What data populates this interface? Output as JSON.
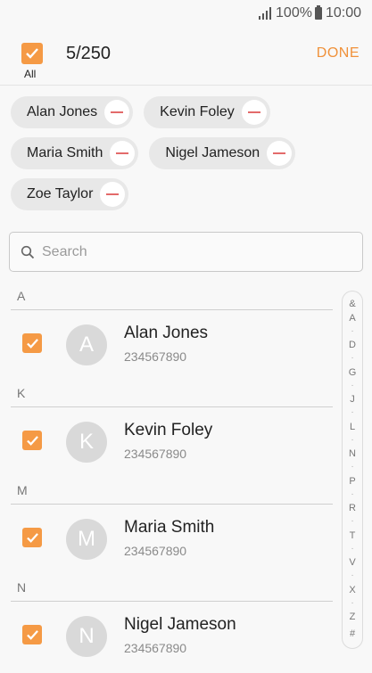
{
  "status_bar": {
    "battery_percent": "100%",
    "time": "10:00"
  },
  "header": {
    "all_label": "All",
    "selected_count": "5/250",
    "done_label": "DONE"
  },
  "chips": [
    {
      "label": "Alan Jones"
    },
    {
      "label": "Kevin Foley"
    },
    {
      "label": "Maria Smith"
    },
    {
      "label": "Nigel Jameson"
    },
    {
      "label": "Zoe Taylor"
    }
  ],
  "search": {
    "placeholder": "Search"
  },
  "sections": [
    {
      "letter": "A",
      "contact": {
        "initial": "A",
        "name": "Alan Jones",
        "phone": "234567890",
        "checked": true
      }
    },
    {
      "letter": "K",
      "contact": {
        "initial": "K",
        "name": "Kevin Foley",
        "phone": "234567890",
        "checked": true
      }
    },
    {
      "letter": "M",
      "contact": {
        "initial": "M",
        "name": "Maria Smith",
        "phone": "234567890",
        "checked": true
      }
    },
    {
      "letter": "N",
      "contact": {
        "initial": "N",
        "name": "Nigel Jameson",
        "phone": "234567890",
        "checked": true
      }
    }
  ],
  "index_bar": [
    "&",
    "A",
    "·",
    "D",
    "·",
    "G",
    "·",
    "J",
    "·",
    "L",
    "·",
    "N",
    "·",
    "P",
    "·",
    "R",
    "·",
    "T",
    "·",
    "V",
    "·",
    "X",
    "·",
    "Z",
    "#"
  ],
  "colors": {
    "accent": "#f59a45",
    "remove_icon": "#e36a6a"
  }
}
